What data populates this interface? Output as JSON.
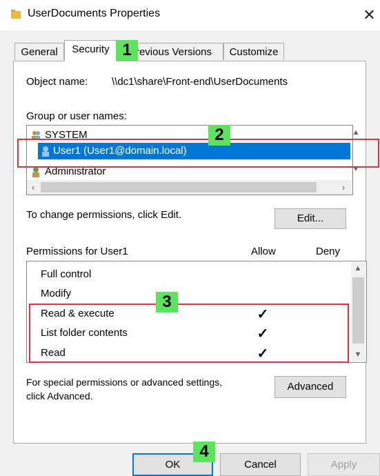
{
  "window": {
    "title": "UserDocuments Properties",
    "close_glyph": "✕"
  },
  "tabs": [
    {
      "label": "General"
    },
    {
      "label": "Security"
    },
    {
      "label": "Previous Versions"
    },
    {
      "label": "Customize"
    }
  ],
  "object": {
    "label": "Object name:",
    "value": "\\\\dc1\\share\\Front-end\\UserDocuments"
  },
  "group": {
    "label": "Group or user names:",
    "items": [
      {
        "label": "SYSTEM",
        "icon": "system-users-icon"
      },
      {
        "label": "User1 (User1@domain.local)",
        "icon": "user-icon"
      },
      {
        "label": "Administrator",
        "icon": "admin-user-icon"
      }
    ]
  },
  "change_text": "To change permissions, click Edit.",
  "edit_button": "Edit...",
  "permissions": {
    "header": "Permissions for User1",
    "allow": "Allow",
    "deny": "Deny",
    "rows": [
      {
        "label": "Full control",
        "allow": ""
      },
      {
        "label": "Modify",
        "allow": ""
      },
      {
        "label": "Read & execute",
        "allow": "✓"
      },
      {
        "label": "List folder contents",
        "allow": "✓"
      },
      {
        "label": "Read",
        "allow": "✓"
      }
    ]
  },
  "advanced": {
    "text_line1": "For special permissions or advanced settings,",
    "text_line2": "click Advanced.",
    "button": "Advanced"
  },
  "buttons": {
    "ok": "OK",
    "cancel": "Cancel",
    "apply": "Apply"
  },
  "annotations": [
    "1",
    "2",
    "3",
    "4"
  ],
  "colors": {
    "selection": "#0078d7",
    "badge": "#5de35d",
    "highlight_box": "#e03040"
  }
}
